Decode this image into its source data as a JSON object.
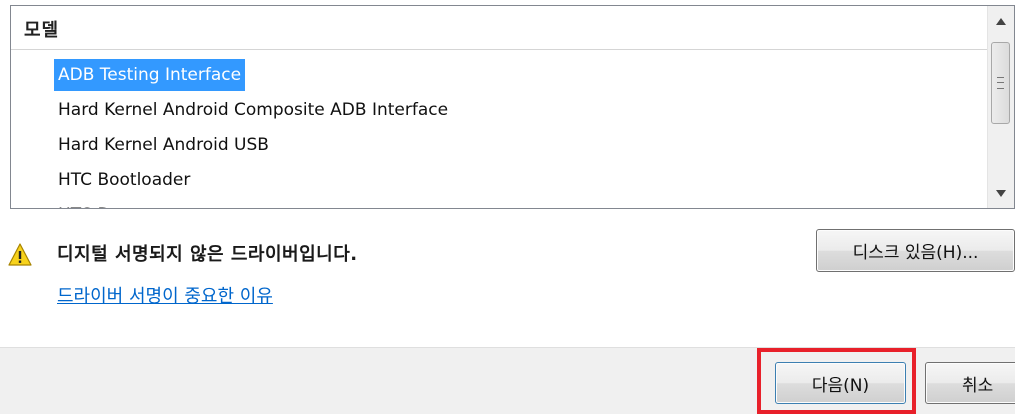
{
  "model_list": {
    "header": "모델",
    "items": [
      {
        "label": "ADB Testing Interface",
        "selected": true
      },
      {
        "label": "Hard Kernel Android Composite ADB Interface",
        "selected": false
      },
      {
        "label": "Hard Kernel Android USB",
        "selected": false
      },
      {
        "label": "HTC Bootloader",
        "selected": false
      },
      {
        "label": "HTC Dream",
        "selected": false
      }
    ]
  },
  "scrollbar": {
    "up_icon": "triangle-up-icon",
    "down_icon": "triangle-down-icon"
  },
  "warning": {
    "icon": "warning-icon",
    "text": "디지털 서명되지 않은 드라이버입니다.",
    "link": "드라이버 서명이 중요한 이유"
  },
  "buttons": {
    "have_disk": "디스크 있음(H)...",
    "next": "다음(N)",
    "cancel": "취소"
  },
  "colors": {
    "selection": "#3399ff",
    "link": "#0066cc",
    "highlight_border": "#e8202a",
    "warning_yellow": "#f7d21c"
  }
}
